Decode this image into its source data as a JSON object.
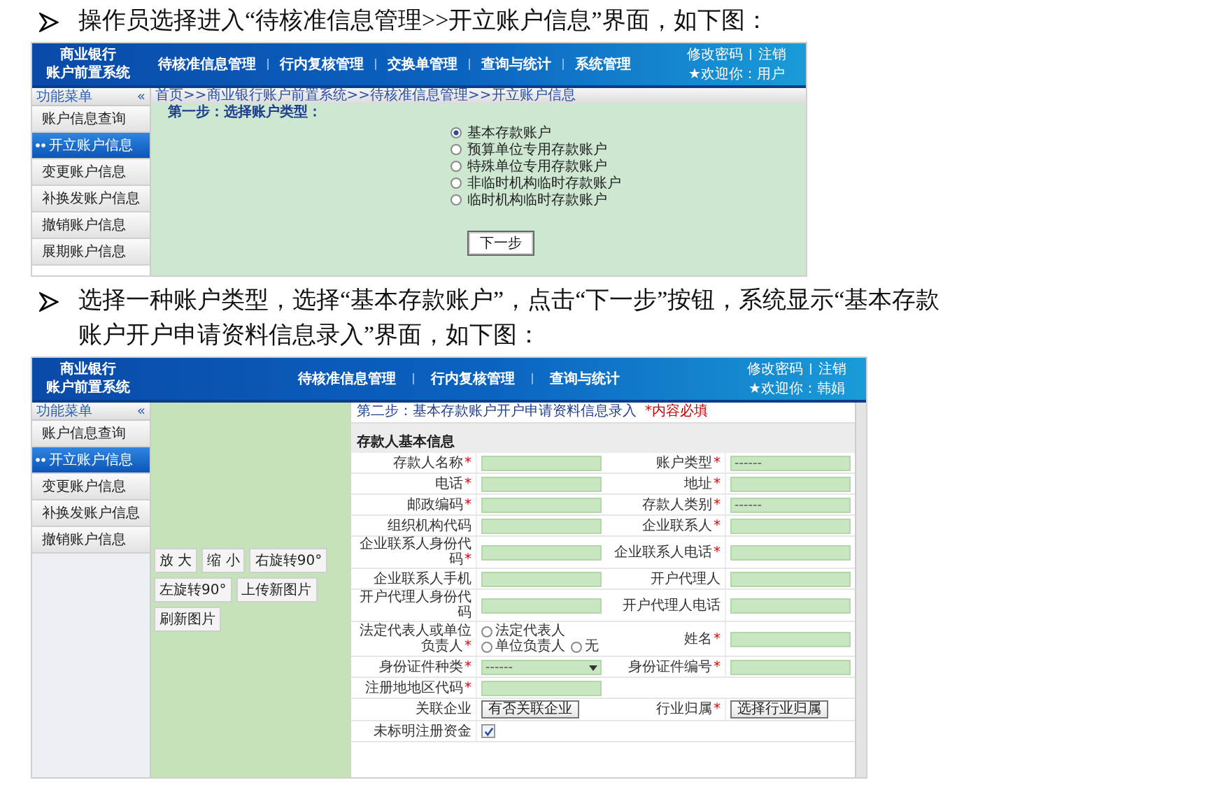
{
  "intro_1": {
    "lines": [
      "操作员选择进入“待核准信息管理>>开立账户信息”界面，如下图："
    ]
  },
  "screenshot_1": {
    "logo": [
      "商业银行",
      "账户前置系统"
    ],
    "nav": [
      "待核准信息管理",
      "行内复核管理",
      "交换单管理",
      "查询与统计",
      "系统管理"
    ],
    "user_links": [
      "修改密码",
      "注销"
    ],
    "welcome": "★欢迎你：用户",
    "menu_title": "功能菜单",
    "collapse": "«",
    "menu": [
      {
        "label": "账户信息查询",
        "selected": false
      },
      {
        "label": "开立账户信息",
        "selected": true
      },
      {
        "label": "变更账户信息",
        "selected": false
      },
      {
        "label": "补换发账户信息",
        "selected": false
      },
      {
        "label": "撤销账户信息",
        "selected": false
      },
      {
        "label": "展期账户信息",
        "selected": false
      }
    ],
    "breadcrumb": "首页>>商业银行账户前置系统>>待核准信息管理>>开立账户信息",
    "step_title": "第一步：选择账户类型：",
    "account_types": [
      {
        "label": "基本存款账户",
        "selected": true
      },
      {
        "label": "预算单位专用存款账户",
        "selected": false
      },
      {
        "label": "特殊单位专用存款账户",
        "selected": false
      },
      {
        "label": "非临时机构临时存款账户",
        "selected": false
      },
      {
        "label": "临时机构临时存款账户",
        "selected": false
      }
    ],
    "next_button": "下一步"
  },
  "intro_2": {
    "lines": [
      "选择一种账户类型，选择“基本存款账户”，点击“下一步”按钮，系统显示“基本存款",
      "账户开户申请资料信息录入”界面，如下图："
    ]
  },
  "screenshot_2": {
    "logo": [
      "商业银行",
      "账户前置系统"
    ],
    "nav": [
      "待核准信息管理",
      "行内复核管理",
      "查询与统计"
    ],
    "user_links": [
      "修改密码",
      "注销"
    ],
    "welcome": "★欢迎你：韩娟",
    "menu_title": "功能菜单",
    "collapse": "«",
    "menu": [
      {
        "label": "账户信息查询",
        "selected": false
      },
      {
        "label": "开立账户信息",
        "selected": true
      },
      {
        "label": "变更账户信息",
        "selected": false
      },
      {
        "label": "补换发账户信息",
        "selected": false
      },
      {
        "label": "撤销账户信息",
        "selected": false
      }
    ],
    "image_tools": [
      "放 大",
      "缩 小",
      "右旋转90°",
      "左旋转90°",
      "上传新图片",
      "刷新图片"
    ],
    "form_title": "第二步：基本存款账户开户申请资料信息录入",
    "required_note": "*内容必填",
    "section": "存款人基本信息",
    "rows": [
      [
        {
          "label": "存款人名称",
          "mark": "*",
          "kind": "text"
        },
        {
          "label": "账户类型",
          "mark": "*",
          "kind": "text",
          "value": "------"
        }
      ],
      [
        {
          "label": "电话",
          "mark": "*",
          "kind": "text"
        },
        {
          "label": "地址",
          "mark": "*",
          "kind": "text"
        }
      ],
      [
        {
          "label": "邮政编码",
          "mark": "*",
          "kind": "text"
        },
        {
          "label": "存款人类别",
          "mark": "*",
          "kind": "text",
          "value": "------"
        }
      ],
      [
        {
          "label": "组织机构代码",
          "kind": "text"
        },
        {
          "label": "企业联系人",
          "mark": "*",
          "kind": "text"
        }
      ],
      [
        {
          "label": "企业联系人身份代码",
          "mark": "*",
          "kind": "text"
        },
        {
          "label": "企业联系人电话",
          "mark": "*",
          "kind": "text"
        }
      ],
      [
        {
          "label": "企业联系人手机",
          "kind": "text"
        },
        {
          "label": "开户代理人",
          "kind": "text"
        }
      ],
      [
        {
          "label": "开户代理人身份代码",
          "kind": "text"
        },
        {
          "label": "开户代理人电话",
          "kind": "text"
        }
      ],
      [
        {
          "label": "法定代表人或单位负责人",
          "mark": "*",
          "kind": "radio",
          "options": [
            {
              "label": "法定代表人",
              "selected": false
            },
            {
              "label": "单位负责人",
              "selected": false
            },
            {
              "label": "无",
              "selected": false
            }
          ]
        },
        {
          "label": "姓名",
          "mark": "*",
          "kind": "text"
        }
      ],
      [
        {
          "label": "身份证件种类",
          "mark": "*",
          "kind": "select",
          "value": "------"
        },
        {
          "label": "身份证件编号",
          "mark": "*",
          "kind": "text"
        }
      ],
      [
        {
          "label": "注册地地区代码",
          "mark": "*",
          "kind": "text"
        }
      ],
      [
        {
          "label": "关联企业",
          "kind": "button",
          "value": "有否关联企业"
        },
        {
          "label": "行业归属",
          "mark": "*",
          "kind": "button",
          "value": "选择行业归属"
        }
      ],
      [
        {
          "label": "未标明注册资金",
          "kind": "checkbox",
          "checked": true
        }
      ]
    ]
  }
}
